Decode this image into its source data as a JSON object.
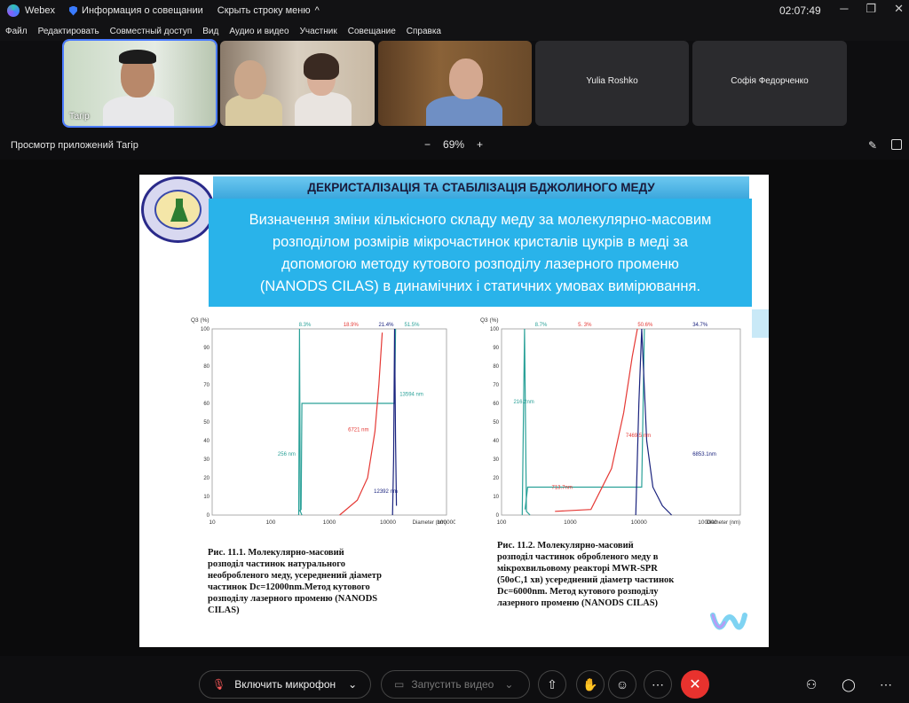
{
  "titlebar": {
    "app_name": "Webex",
    "meeting_info": "Информация о совещании",
    "hide_menu": "Скрыть строку меню",
    "clock": "02:07:49"
  },
  "menu": [
    "Файл",
    "Редактировать",
    "Совместный доступ",
    "Вид",
    "Аудио и видео",
    "Участник",
    "Совещание",
    "Справка"
  ],
  "participants": [
    {
      "name": "Тагір"
    },
    {
      "name": ""
    },
    {
      "name": ""
    },
    {
      "name": "Yulia Roshko"
    },
    {
      "name": "Софія Федорченко"
    }
  ],
  "view": {
    "title": "Просмотр приложений Тагір",
    "zoom_minus": "−",
    "zoom": "69%",
    "zoom_plus": "+"
  },
  "slide": {
    "header": "ДЕКРИСТАЛІЗАЦІЯ  ТА СТАБІЛІЗАЦІЯ БДЖОЛИНОГО МЕДУ",
    "subtitle_lines": [
      "Визначення зміни кількісного складу меду за молекулярно-масовим",
      "розподілом розмірів мікрочастинок кристалів цукрів в  меді за",
      "допомогою методу кутового розподілу лазерного променю",
      "(NANODS CILAS) в динамічних  і статичних умовах  вимірювання."
    ],
    "caption1_lines": [
      "Рис.      11.1.      Молекулярно-масовий",
      "розподіл      частинок      натурального",
      "необробленого меду, усереднений діаметр",
      "частинок      Dc=12000nm.Метод      кутового",
      "розподілу лазерного променю (NANODS",
      "CILAS)"
    ],
    "caption2_lines": [
      "Рис.      11.2.      Молекулярно-масовий",
      "розподіл частинок обробленого    меду в",
      "мікрохвильовому реакторі    MWR-SPR",
      "(50oC,1 хв)  усереднений діаметр частинок",
      "Dc=6000nm.    Метод    кутового    розподілу",
      "лазерного променю (NANODS CILAS)"
    ]
  },
  "chart_data": [
    {
      "type": "line",
      "ylabel": "Q3 (%)",
      "xlabel": "Diameter (nm)",
      "x_ticks": [
        "10",
        "100",
        "1000",
        "10000",
        "100000"
      ],
      "y_ticks": [
        "0",
        "10",
        "20",
        "30",
        "40",
        "50",
        "60",
        "70",
        "80",
        "90",
        "100"
      ],
      "x_scale": "log",
      "xlim": [
        10,
        100000
      ],
      "ylim": [
        0,
        100
      ],
      "annotations": [
        "8.3%",
        "18.9%",
        "21.4%",
        "51.5%",
        "256 nm",
        "6721 nm",
        "12392 nm",
        "13594 nm"
      ],
      "series": [
        {
          "color": "#2aa198",
          "points": [
            [
              300,
              0
            ],
            [
              310,
              100
            ],
            [
              320,
              2
            ],
            [
              340,
              0
            ]
          ]
        },
        {
          "color": "#2aa198",
          "points": [
            [
              300,
              2
            ],
            [
              330,
              3
            ],
            [
              340,
              60
            ],
            [
              13000,
              60
            ],
            [
              13500,
              100
            ]
          ]
        },
        {
          "color": "#e53935",
          "points": [
            [
              1500,
              0
            ],
            [
              3000,
              8
            ],
            [
              4500,
              20
            ],
            [
              6000,
              45
            ],
            [
              7000,
              70
            ],
            [
              8000,
              98
            ]
          ]
        },
        {
          "color": "#1a237e",
          "points": [
            [
              12000,
              0
            ],
            [
              12500,
              30
            ],
            [
              13000,
              100
            ],
            [
              13500,
              40
            ],
            [
              14000,
              5
            ]
          ]
        }
      ]
    },
    {
      "type": "line",
      "ylabel": "Q3 (%)",
      "xlabel": "Diameter (nm)",
      "x_ticks": [
        "100",
        "1000",
        "10000",
        "100000"
      ],
      "y_ticks": [
        "0",
        "10",
        "20",
        "30",
        "40",
        "50",
        "60",
        "70",
        "80",
        "90",
        "100"
      ],
      "x_scale": "log",
      "xlim": [
        100,
        300000
      ],
      "ylim": [
        0,
        100
      ],
      "annotations": [
        "8.7%",
        "5. 3%",
        "50.6%",
        "34.7%",
        "216.2nm",
        "713.7nm",
        "7469.5 nm",
        "6853.1nm"
      ],
      "series": [
        {
          "color": "#2aa198",
          "points": [
            [
              200,
              0
            ],
            [
              216,
              100
            ],
            [
              230,
              2
            ],
            [
              260,
              0
            ]
          ]
        },
        {
          "color": "#2aa198",
          "points": [
            [
              220,
              3
            ],
            [
              240,
              15
            ],
            [
              11000,
              15
            ],
            [
              12000,
              100
            ]
          ]
        },
        {
          "color": "#e53935",
          "points": [
            [
              600,
              2
            ],
            [
              2000,
              3
            ],
            [
              4000,
              25
            ],
            [
              6000,
              55
            ],
            [
              8000,
              85
            ],
            [
              9500,
              100
            ]
          ]
        },
        {
          "color": "#1a237e",
          "points": [
            [
              9000,
              0
            ],
            [
              10000,
              60
            ],
            [
              11000,
              100
            ],
            [
              13000,
              40
            ],
            [
              16000,
              15
            ],
            [
              22000,
              5
            ],
            [
              30000,
              0
            ]
          ]
        }
      ]
    }
  ],
  "controls": {
    "mic": "Включить микрофон",
    "video": "Запустить видео"
  }
}
